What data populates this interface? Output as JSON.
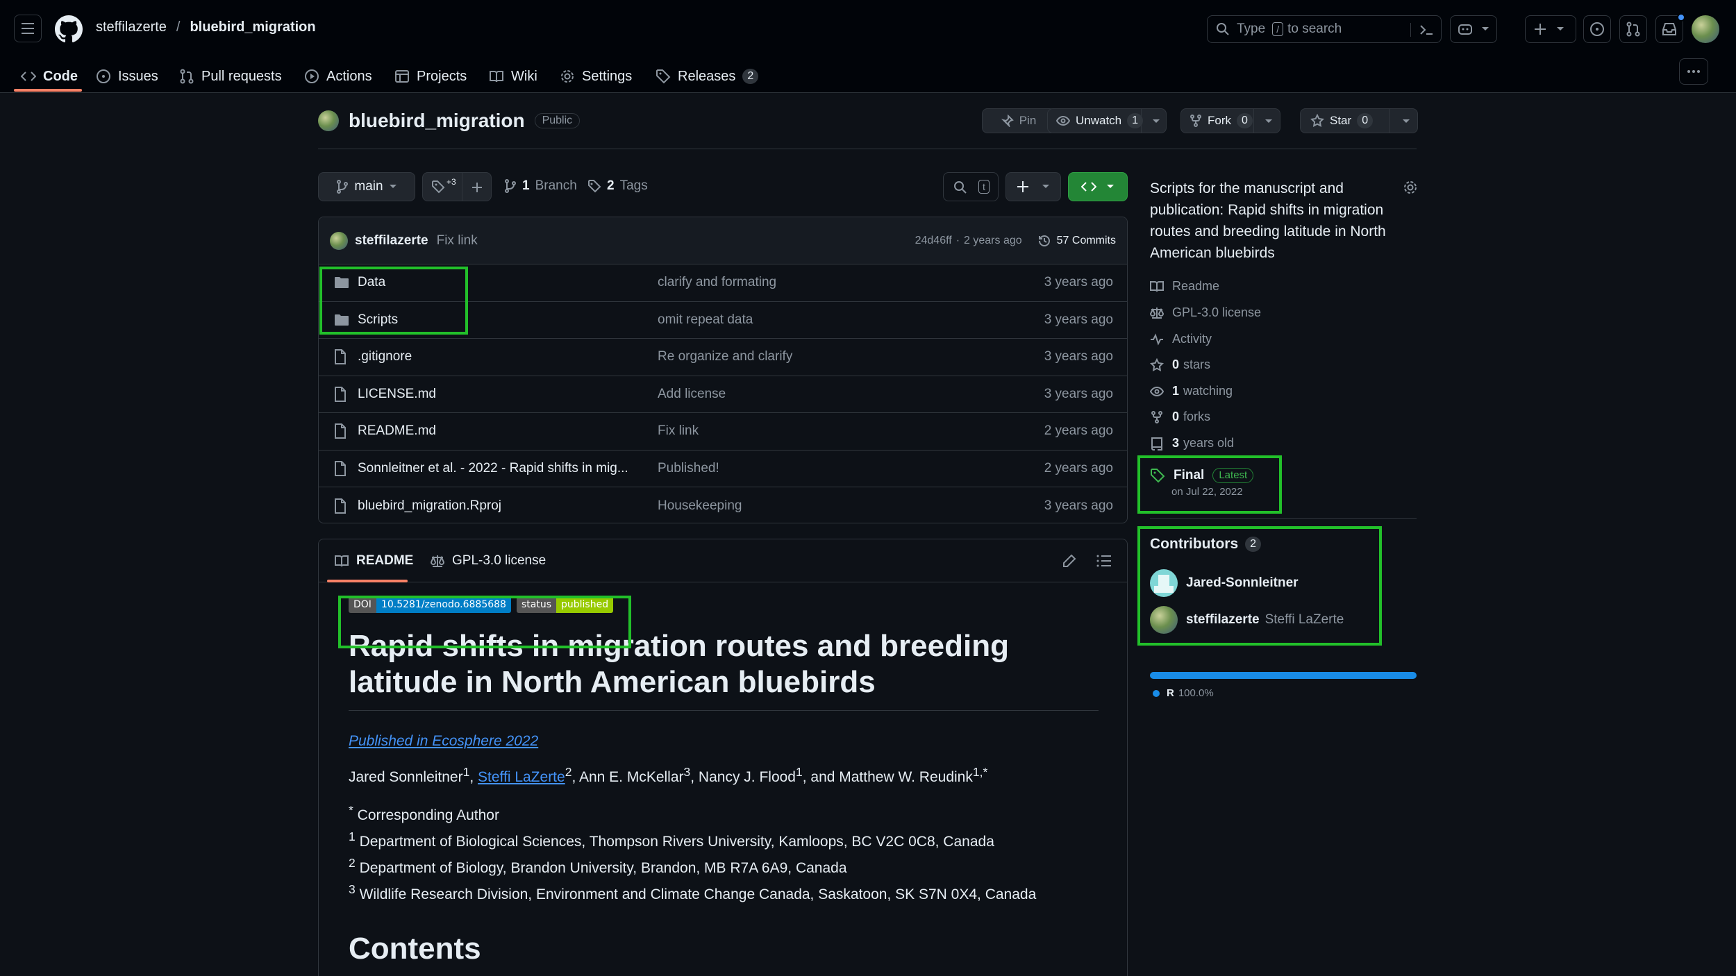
{
  "header": {
    "owner": "steffilazerte",
    "separator": "/",
    "repo": "bluebird_migration",
    "search_prefix": "Type",
    "search_key": "/",
    "search_suffix": "to search"
  },
  "nav_tabs": [
    {
      "label": "Code",
      "icon": "code-icon"
    },
    {
      "label": "Issues",
      "icon": "issue-icon"
    },
    {
      "label": "Pull requests",
      "icon": "pull-request-icon"
    },
    {
      "label": "Actions",
      "icon": "play-icon"
    },
    {
      "label": "Projects",
      "icon": "table-icon"
    },
    {
      "label": "Wiki",
      "icon": "book-icon"
    },
    {
      "label": "Settings",
      "icon": "gear-icon"
    },
    {
      "label": "Releases",
      "icon": "tag-icon",
      "count": "2"
    }
  ],
  "repo_header": {
    "name": "bluebird_migration",
    "visibility": "Public",
    "pin_label": "Pin",
    "unwatch_label": "Unwatch",
    "unwatch_count": "1",
    "fork_label": "Fork",
    "fork_count": "0",
    "star_label": "Star",
    "star_count": "0"
  },
  "branch_bar": {
    "branch": "main",
    "tags_superscript": "+3",
    "branch_count": "1",
    "branch_label": "Branch",
    "tag_count": "2",
    "tag_label": "Tags",
    "shortcut_key": "t"
  },
  "commit": {
    "author": "steffilazerte",
    "message": "Fix link",
    "hash": "24d46ff",
    "dot": "·",
    "time": "2 years ago",
    "commits_label": "57 Commits"
  },
  "files": [
    {
      "name": "Data",
      "type": "folder",
      "message": "clarify and formating",
      "date": "3 years ago"
    },
    {
      "name": "Scripts",
      "type": "folder",
      "message": "omit repeat data",
      "date": "3 years ago"
    },
    {
      "name": ".gitignore",
      "type": "file",
      "message": "Re organize and clarify",
      "date": "3 years ago"
    },
    {
      "name": "LICENSE.md",
      "type": "file",
      "message": "Add license",
      "date": "3 years ago"
    },
    {
      "name": "README.md",
      "type": "file",
      "message": "Fix link",
      "date": "2 years ago"
    },
    {
      "name": "Sonnleitner et al. - 2022 - Rapid shifts in mig...",
      "type": "file",
      "message": "Published!",
      "date": "2 years ago"
    },
    {
      "name": "bluebird_migration.Rproj",
      "type": "file",
      "message": "Housekeeping",
      "date": "3 years ago"
    }
  ],
  "readme": {
    "tab_readme": "README",
    "tab_license": "GPL-3.0 license",
    "badge_doi_left": "DOI",
    "badge_doi_right": "10.5281/zenodo.6885688",
    "badge_status_left": "status",
    "badge_status_right": "published",
    "title": "Rapid shifts in migration routes and breeding latitude in North American bluebirds",
    "published_link": "Published in Ecosphere 2022",
    "author1": "Jared Sonnleitner",
    "author1_sup": "1",
    "comma1": ", ",
    "author2": "Steffi LaZerte",
    "author2_sup": "2",
    "author3": ", Ann E. McKellar",
    "author3_sup": "3",
    "author4": ", Nancy J. Flood",
    "author4_sup": "1",
    "author5": ", and Matthew W. Reudink",
    "author5_sup": "1,*",
    "aff_star_sup": "*",
    "aff_star": " Corresponding Author",
    "aff1_sup": "1",
    "aff1": " Department of Biological Sciences, Thompson Rivers University, Kamloops, BC V2C 0C8, Canada",
    "aff2_sup": "2",
    "aff2": " Department of Biology, Brandon University, Brandon, MB R7A 6A9, Canada",
    "aff3_sup": "3",
    "aff3": " Wildlife Research Division, Environment and Climate Change Canada, Saskatoon, SK S7N 0X4, Canada",
    "contents_heading": "Contents"
  },
  "sidebar": {
    "about": "Scripts for the manuscript and publication: Rapid shifts in migration routes and breeding latitude in North American bluebirds",
    "readme": "Readme",
    "license": "GPL-3.0 license",
    "activity": "Activity",
    "stars_count": "0",
    "stars_label": "stars",
    "watching_count": "1",
    "watching_label": "watching",
    "forks_count": "0",
    "forks_label": "forks",
    "age_count": "3",
    "age_label": "years old",
    "release_name": "Final",
    "release_badge": "Latest",
    "release_date": "on Jul 22, 2022",
    "contributors_heading": "Contributors",
    "contributors_count": "2",
    "contributors": [
      {
        "login": "Jared-Sonnleitner",
        "name": ""
      },
      {
        "login": "steffilazerte",
        "name": "Steffi LaZerte"
      }
    ],
    "language": "R",
    "language_percent": "100.0%",
    "language_share": 1.0,
    "language_color": "#198CE7"
  },
  "colors": {
    "accent_green": "#238636",
    "highlight": "#22c02a",
    "link": "#4493f8",
    "underline": "#f78166"
  }
}
